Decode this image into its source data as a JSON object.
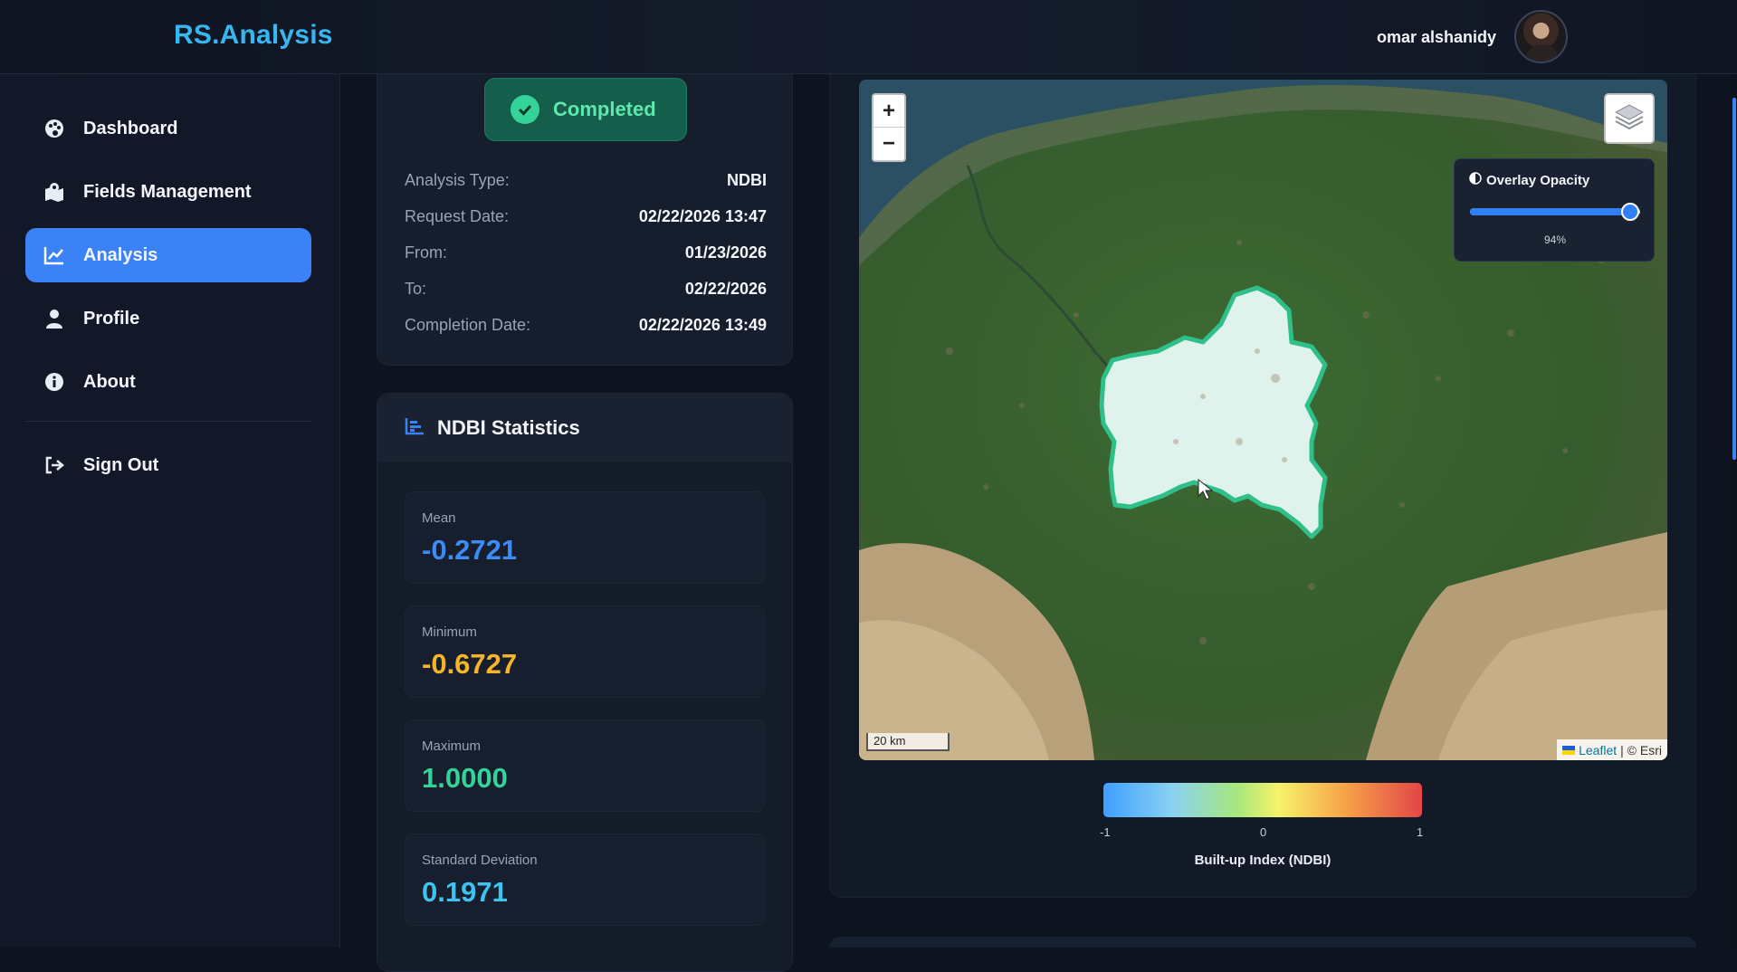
{
  "app": {
    "brand": "RS.Analysis"
  },
  "user": {
    "name": "omar alshanidy"
  },
  "sidebar": {
    "items": [
      {
        "label": "Dashboard",
        "icon": "palette-icon",
        "active": false
      },
      {
        "label": "Fields Management",
        "icon": "map-marker-icon",
        "active": false
      },
      {
        "label": "Analysis",
        "icon": "chart-line-icon",
        "active": true
      },
      {
        "label": "Profile",
        "icon": "user-icon",
        "active": false
      },
      {
        "label": "About",
        "icon": "info-icon",
        "active": false
      }
    ],
    "signout": {
      "label": "Sign Out",
      "icon": "sign-out-icon"
    }
  },
  "analysis": {
    "status": "Completed",
    "rows": [
      {
        "label": "Analysis Type:",
        "value": "NDBI"
      },
      {
        "label": "Request Date:",
        "value": "02/22/2026 13:47"
      },
      {
        "label": "From:",
        "value": "01/23/2026"
      },
      {
        "label": "To:",
        "value": "02/22/2026"
      },
      {
        "label": "Completion Date:",
        "value": "02/22/2026 13:49"
      }
    ]
  },
  "stats": {
    "title": "NDBI Statistics",
    "items": [
      {
        "label": "Mean",
        "value": "-0.2721",
        "color": "#3b8cf5"
      },
      {
        "label": "Minimum",
        "value": "-0.6727",
        "color": "#f5b42a"
      },
      {
        "label": "Maximum",
        "value": "1.0000",
        "color": "#34d399"
      },
      {
        "label": "Standard Deviation",
        "value": "0.1971",
        "color": "#3ec3f0"
      }
    ]
  },
  "map": {
    "zoom_in": "+",
    "zoom_out": "−",
    "opacity_title": "Overlay Opacity",
    "opacity_value": "94%",
    "opacity_fraction": 0.94,
    "scale": "20 km",
    "attribution_link": "Leaflet",
    "attribution_rest": "| © Esri"
  },
  "legend": {
    "title": "Built-up Index (NDBI)",
    "ticks": [
      "-1",
      "0",
      "1"
    ]
  }
}
